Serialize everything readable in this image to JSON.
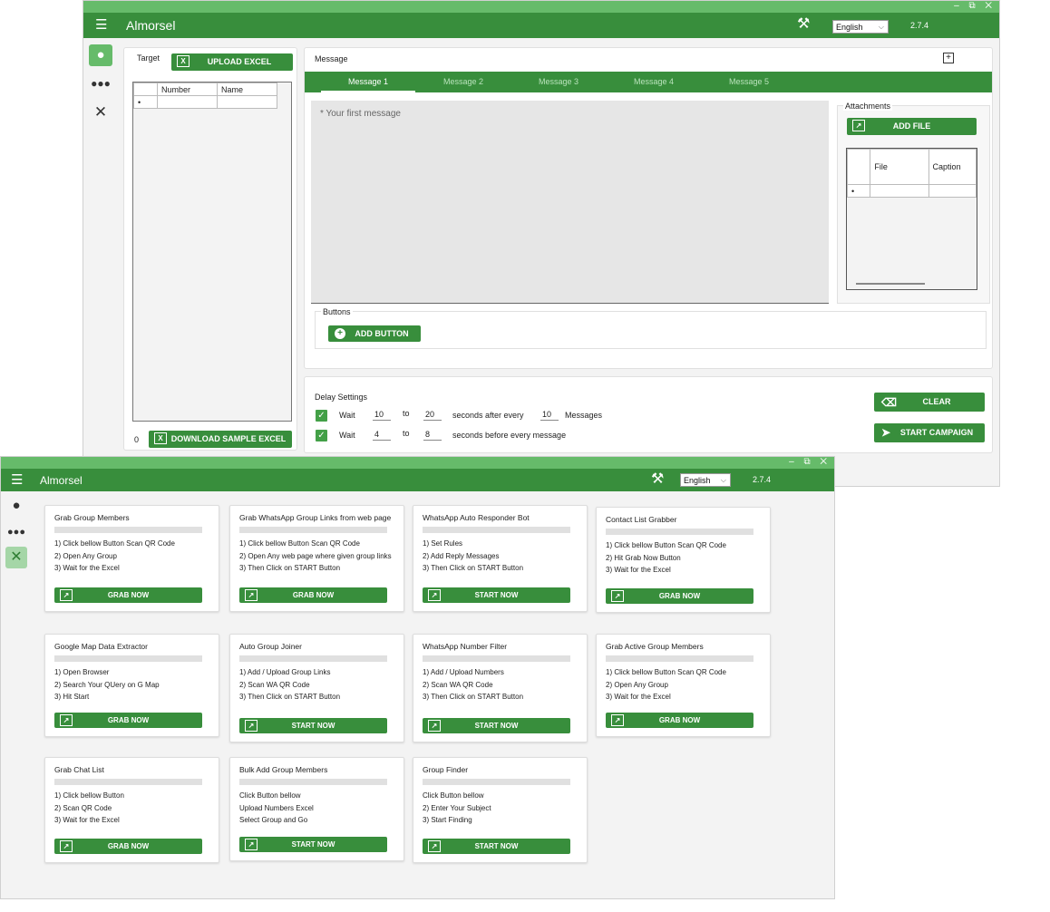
{
  "app": {
    "name": "Almorsel",
    "version": "2.7.4",
    "language": "English",
    "window_controls": "– ⧉ ✕"
  },
  "colors": {
    "topbar": "#66bb6a",
    "appbar": "#388e3c",
    "button": "#388e3c",
    "checkbox": "#43a047"
  },
  "target": {
    "label": "Target",
    "upload_button": "UPLOAD EXCEL",
    "columns": [
      "Number",
      "Name"
    ],
    "row_marker": "•",
    "count": "0",
    "download_button": "DOWNLOAD SAMPLE EXCEL"
  },
  "message": {
    "label": "Message",
    "tabs": [
      "Message 1",
      "Message 2",
      "Message 3",
      "Message 4",
      "Message 5"
    ],
    "selected_tab": 0,
    "placeholder": "* Your first message",
    "add_icon": "plus-square-icon"
  },
  "attachments": {
    "label": "Attachments",
    "add_button": "ADD FILE",
    "columns": [
      "File",
      "Caption"
    ],
    "row_marker": "•"
  },
  "buttons_section": {
    "label": "Buttons",
    "add_button": "ADD BUTTON"
  },
  "delay": {
    "label": "Delay Settings",
    "row1": {
      "wait": "Wait",
      "from": "10",
      "to_label": "to",
      "to": "20",
      "text": "seconds after every",
      "count": "10",
      "suffix": "Messages"
    },
    "row2": {
      "wait": "Wait",
      "from": "4",
      "to_label": "to",
      "to": "8",
      "text": "seconds before every message"
    }
  },
  "actions": {
    "clear": "CLEAR",
    "start": "START CAMPAIGN"
  },
  "tools": [
    {
      "title": "Grab Group Members",
      "lines": [
        "1) Click bellow Button Scan QR Code",
        "2) Open Any Group",
        "3) Wait for the Excel"
      ],
      "button": "GRAB NOW"
    },
    {
      "title": "Grab WhatsApp Group Links from web page",
      "lines": [
        "1) Click bellow Button Scan QR Code",
        "2) Open Any web page where given group links",
        "3) Then Click on START Button"
      ],
      "button": "GRAB NOW"
    },
    {
      "title": "WhatsApp Auto Responder Bot",
      "lines": [
        "1) Set Rules",
        "2) Add Reply Messages",
        "3) Then Click on START Button"
      ],
      "button": "START NOW"
    },
    {
      "title": "Contact List Grabber",
      "lines": [
        "1) Click bellow Button Scan QR Code",
        "2) Hit Grab Now Button",
        "3) Wait for the Excel"
      ],
      "button": "GRAB NOW"
    },
    {
      "title": "Google Map Data Extractor",
      "lines": [
        "1) Open Browser",
        "2) Search Your QUery on G Map",
        "3) Hit Start"
      ],
      "button": "GRAB NOW"
    },
    {
      "title": "Auto Group Joiner",
      "lines": [
        "1) Add / Upload Group Links",
        "2) Scan WA QR Code",
        "3) Then Click on START Button"
      ],
      "button": "START NOW"
    },
    {
      "title": "WhatsApp Number Filter",
      "lines": [
        "1) Add / Upload Numbers",
        "2) Scan WA QR Code",
        "3) Then Click on START Button"
      ],
      "button": "START NOW"
    },
    {
      "title": "Grab Active Group Members",
      "lines": [
        "1) Click bellow Button Scan QR Code",
        "2) Open Any Group",
        "3) Wait for the Excel"
      ],
      "button": "GRAB NOW"
    },
    {
      "title": "Grab Chat List",
      "lines": [
        "1) Click bellow Button",
        "2) Scan QR Code",
        "3) Wait for the Excel"
      ],
      "button": "GRAB NOW"
    },
    {
      "title": "Bulk Add Group Members",
      "lines": [
        "Click Button bellow",
        "Upload Numbers Excel",
        "Select Group and Go"
      ],
      "button": "START NOW"
    },
    {
      "title": "Group Finder",
      "lines": [
        "Click Button bellow",
        "2) Enter Your Subject",
        "3) Start Finding"
      ],
      "button": "START NOW"
    }
  ]
}
